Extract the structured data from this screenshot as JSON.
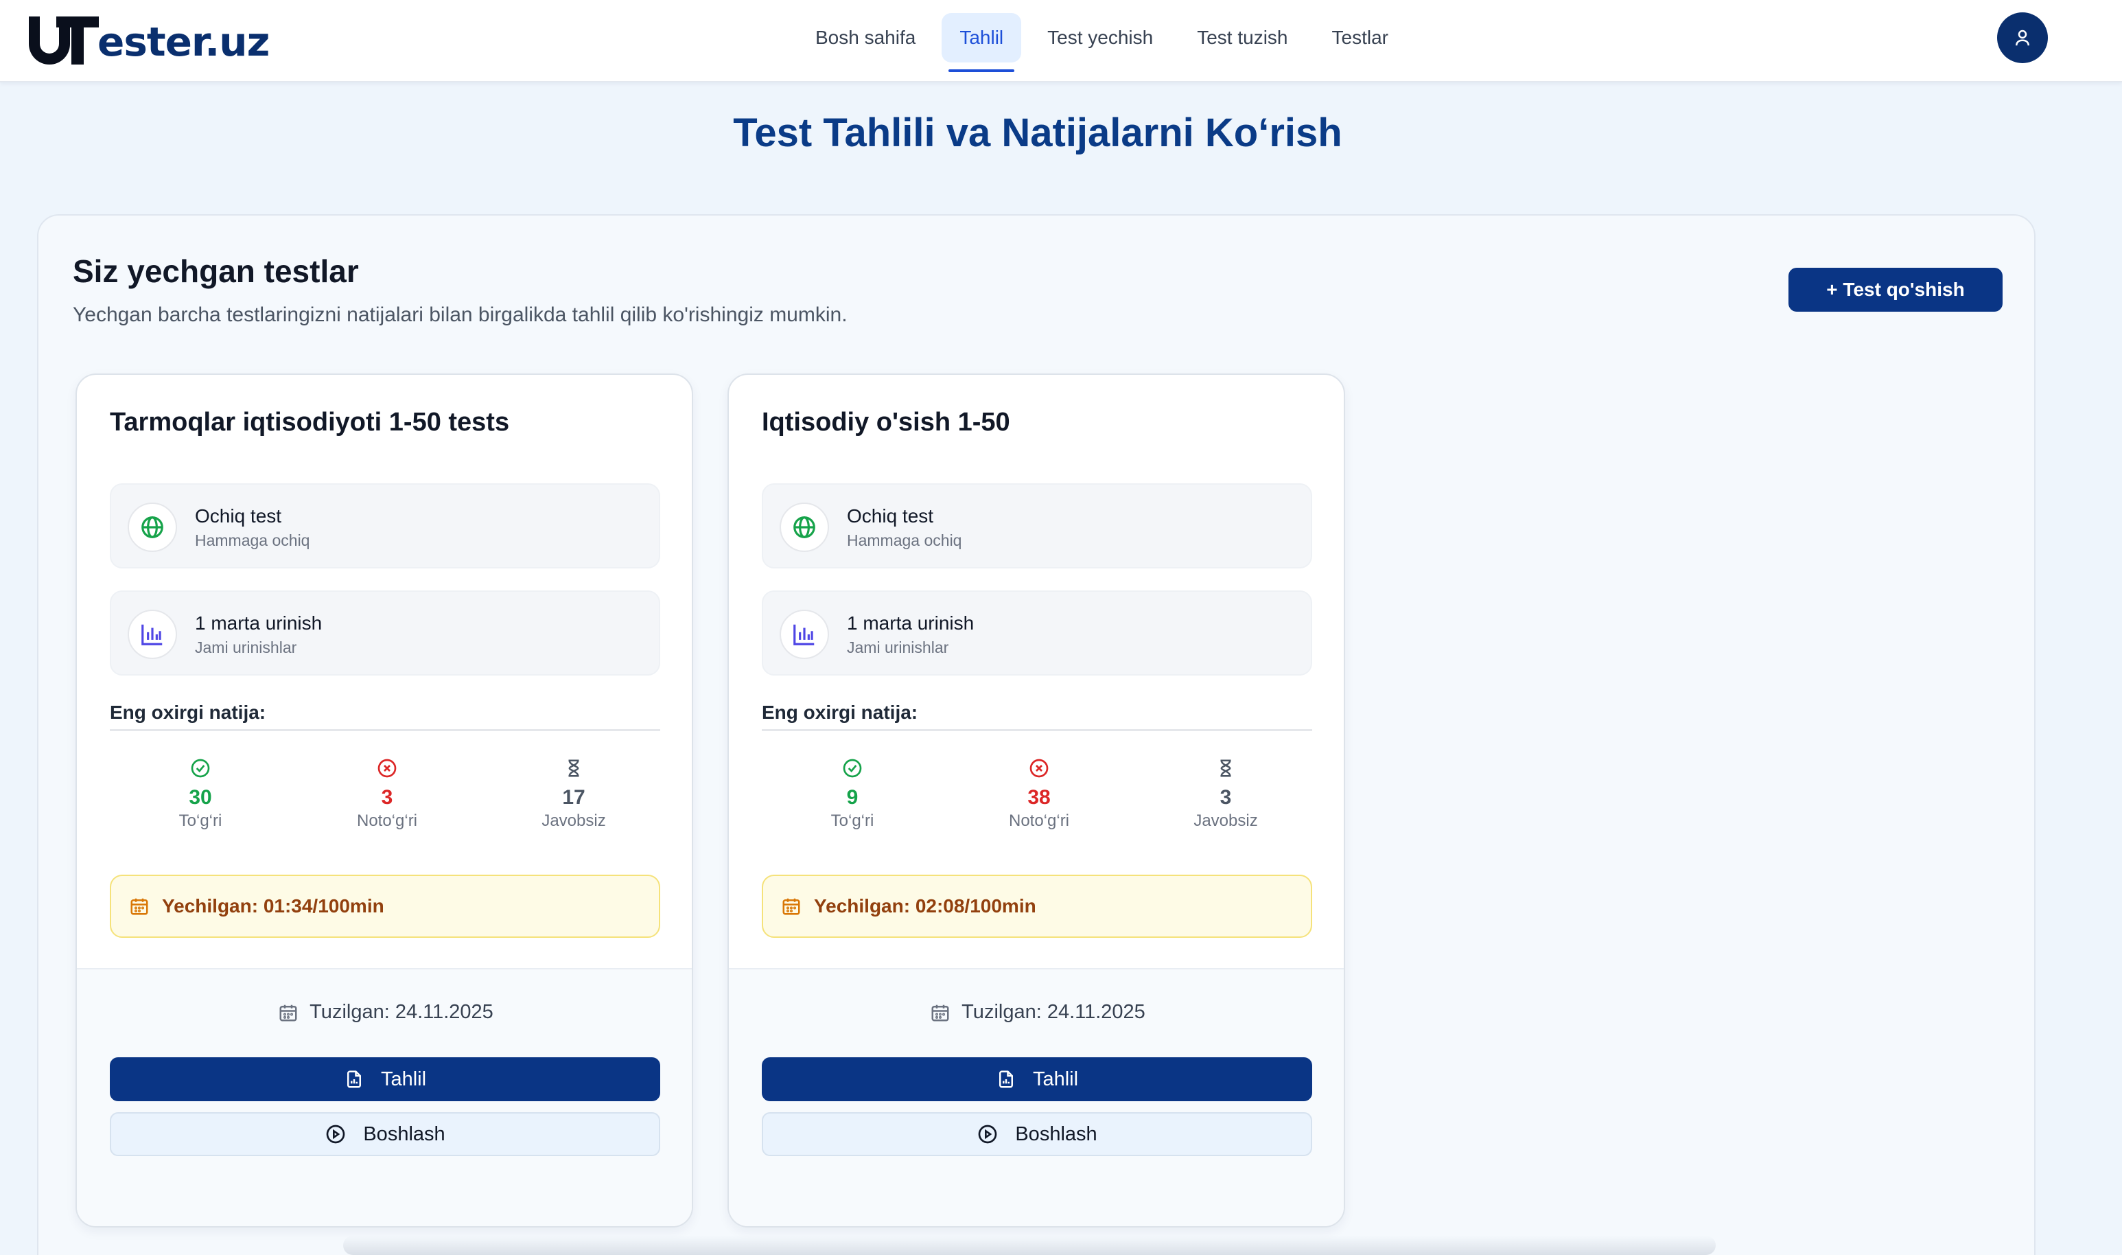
{
  "logo": {
    "mark": "U",
    "text": "ester.uz"
  },
  "nav": {
    "items": [
      {
        "label": "Bosh sahifa",
        "active": false
      },
      {
        "label": "Tahlil",
        "active": true
      },
      {
        "label": "Test yechish",
        "active": false
      },
      {
        "label": "Test tuzish",
        "active": false
      },
      {
        "label": "Testlar",
        "active": false
      }
    ]
  },
  "page": {
    "title": "Test Tahlili va Natijalarni Ko‘rish"
  },
  "section": {
    "title": "Siz yechgan testlar",
    "subtitle": "Yechgan barcha testlaringizni natijalari bilan birgalikda tahlil qilib ko'rishingiz mumkin.",
    "add_button": "+ Test qo'shish"
  },
  "cards": [
    {
      "title": "Tarmoqlar iqtisodiyoti 1-50 tests",
      "access": {
        "main": "Ochiq test",
        "sub": "Hammaga ochiq"
      },
      "attempts": {
        "main": "1 marta urinish",
        "sub": "Jami urinishlar"
      },
      "last_result_label": "Eng oxirgi natija:",
      "correct": {
        "value": "30",
        "label": "To‘g‘ri"
      },
      "wrong": {
        "value": "3",
        "label": "Noto‘g‘ri"
      },
      "unanswered": {
        "value": "17",
        "label": "Javobsiz"
      },
      "solved": "Yechilgan: 01:34/100min",
      "created": "Tuzilgan: 24.11.2025",
      "analyze_button": "Tahlil",
      "start_button": "Boshlash"
    },
    {
      "title": "Iqtisodiy o'sish 1-50",
      "access": {
        "main": "Ochiq test",
        "sub": "Hammaga ochiq"
      },
      "attempts": {
        "main": "1 marta urinish",
        "sub": "Jami urinishlar"
      },
      "last_result_label": "Eng oxirgi natija:",
      "correct": {
        "value": "9",
        "label": "To‘g‘ri"
      },
      "wrong": {
        "value": "38",
        "label": "Noto‘g‘ri"
      },
      "unanswered": {
        "value": "3",
        "label": "Javobsiz"
      },
      "solved": "Yechilgan: 02:08/100min",
      "created": "Tuzilgan: 24.11.2025",
      "analyze_button": "Tahlil",
      "start_button": "Boshlash"
    }
  ],
  "colors": {
    "brand": "#0a3585",
    "accent_active": "#1d4fd8",
    "correct": "#15a34a",
    "wrong": "#dc2626",
    "time_bg": "#fefbe6"
  }
}
